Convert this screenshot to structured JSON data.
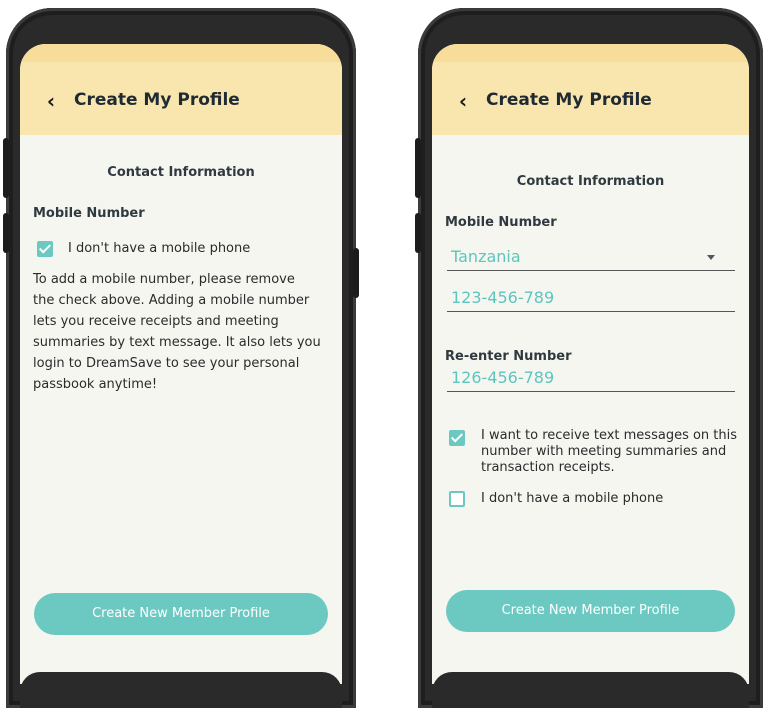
{
  "left_screen": {
    "title": "Create My Profile",
    "section_title": "Contact Information",
    "mobile_label": "Mobile Number",
    "no_mobile_checkbox": {
      "label": "I don't have a mobile phone",
      "checked": true
    },
    "help_lines": [
      "To add a mobile number, please remove",
      "the check above. Adding a mobile number",
      "lets you receive receipts and meeting",
      "summaries by text message. It also lets you",
      "login to DreamSave to see your personal",
      "passbook anytime!"
    ],
    "cta_label": "Create New Member Profile"
  },
  "right_screen": {
    "title": "Create My Profile",
    "section_title": "Contact Information",
    "mobile_label": "Mobile Number",
    "country_select": "Tanzania",
    "mobile_value": "123-456-789",
    "reenter_label": "Re-enter Number",
    "reenter_value": "126-456-789",
    "sms_checkbox": {
      "checked": true,
      "lines": [
        "I want to receive text messages on this",
        "number with meeting summaries and",
        "transaction receipts."
      ]
    },
    "no_mobile_checkbox": {
      "label": "I don't have a mobile phone",
      "checked": false
    },
    "cta_label": "Create New Member Profile"
  },
  "colors": {
    "accent": "#6cc9c2",
    "header": "#f9e6ae",
    "screen_bg": "#f6f6f1"
  }
}
